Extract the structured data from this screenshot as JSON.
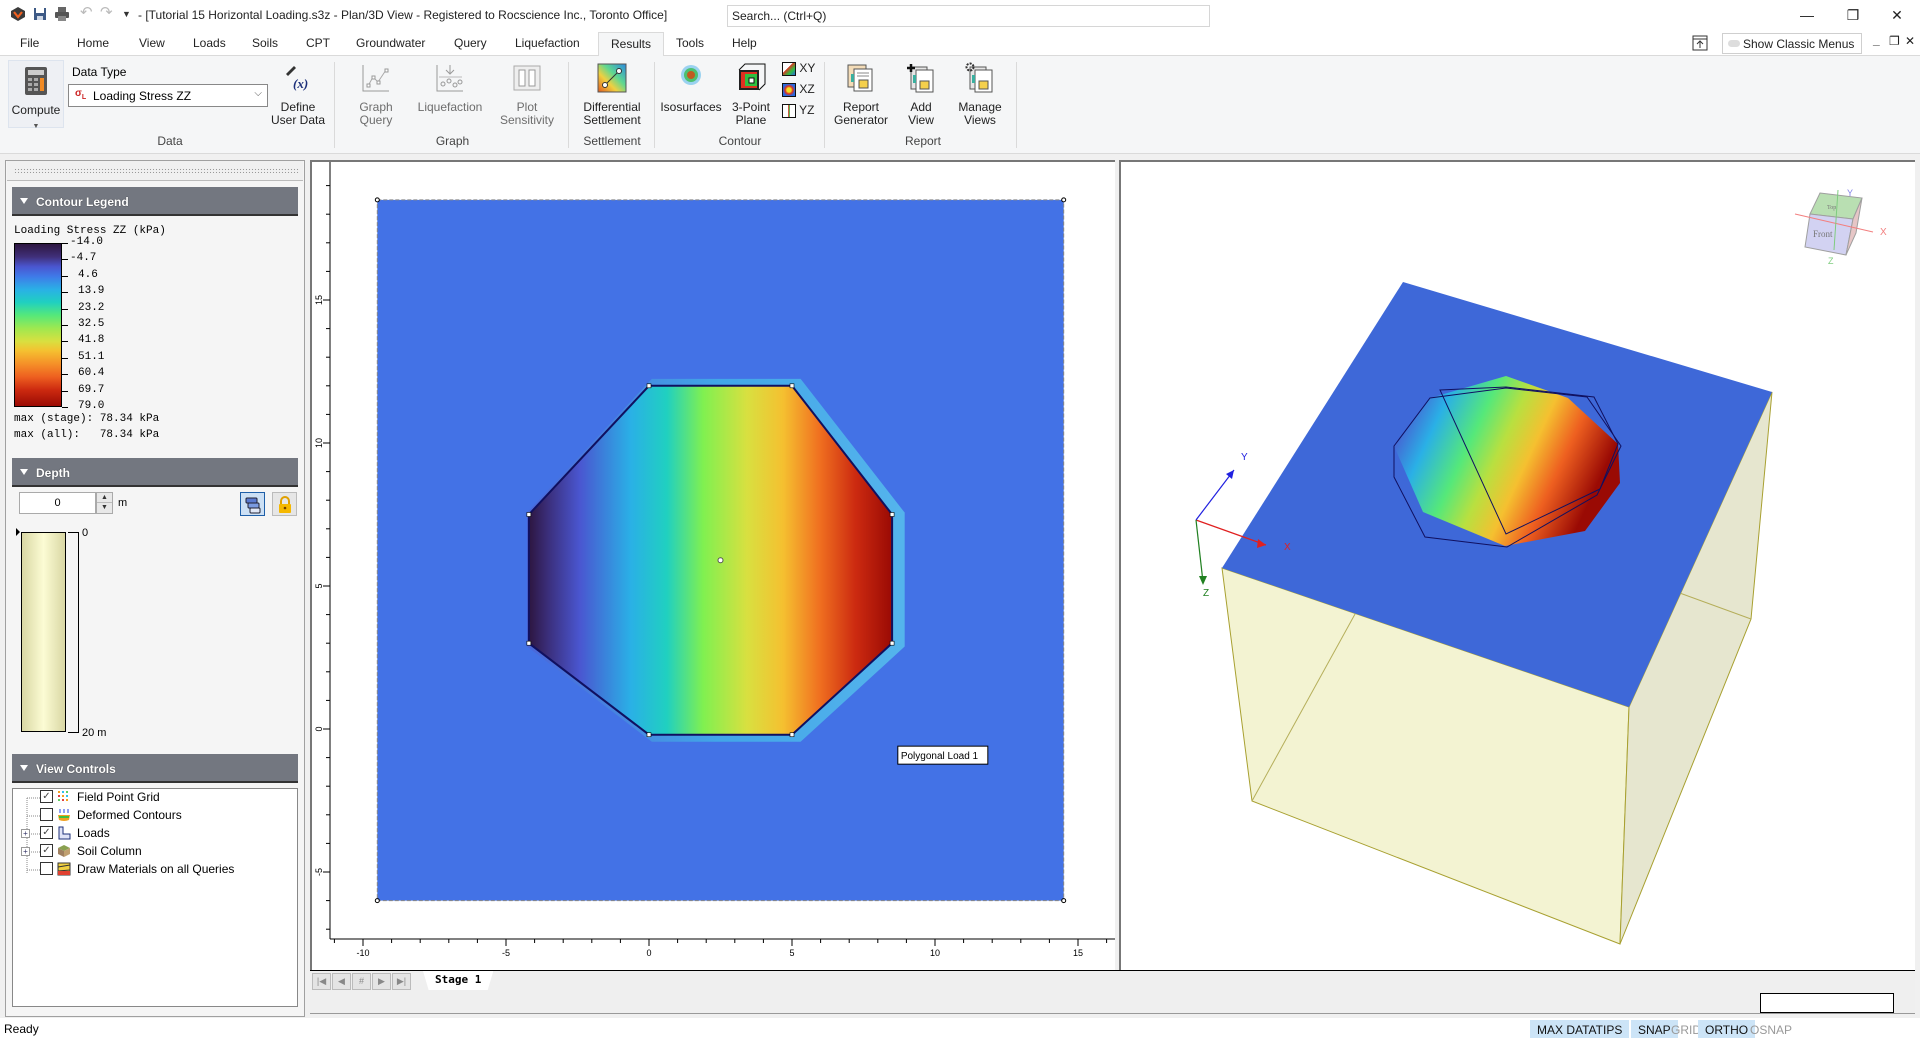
{
  "window": {
    "title": "- [Tutorial 15 Horizontal Loading.s3z - Plan/3D View - Registered to Rocscience Inc., Toronto Office]",
    "search_placeholder": "Search... (Ctrl+Q)",
    "minimize": "—",
    "maximize": "❐",
    "close": "✕",
    "quick_access": [
      "app-logo-icon",
      "save-icon",
      "print-icon",
      "undo-icon",
      "redo-icon",
      "customize-dropdown-icon"
    ]
  },
  "menu": {
    "tabs": [
      "File",
      "Home",
      "View",
      "Loads",
      "Soils",
      "CPT",
      "Groundwater",
      "Query",
      "Liquefaction",
      "Results",
      "Tools",
      "Help"
    ],
    "active_tab": "Results",
    "show_classic_menus": "Show Classic Menus",
    "doc_minimize": "_",
    "doc_restore": "❐",
    "doc_close": "✕"
  },
  "ribbon": {
    "groups": {
      "data": "Data",
      "graph": "Graph",
      "settlement": "Settlement",
      "contour": "Contour",
      "report": "Report"
    },
    "compute": "Compute",
    "data_type_label": "Data Type",
    "data_type_value": "Loading Stress ZZ",
    "define_user_data": [
      "Define",
      "User Data"
    ],
    "graph_query": [
      "Graph",
      "Query"
    ],
    "liquefaction": "Liquefaction",
    "plot_sensitivity": [
      "Plot",
      "Sensitivity"
    ],
    "differential_settlement": [
      "Differential",
      "Settlement"
    ],
    "isosurfaces": "Isosurfaces",
    "three_point_plane": [
      "3-Point",
      "Plane"
    ],
    "plane_xy": "XY",
    "plane_xz": "XZ",
    "plane_yz": "YZ",
    "report_generator": [
      "Report",
      "Generator"
    ],
    "add_view": [
      "Add",
      "View"
    ],
    "manage_views": [
      "Manage",
      "Views"
    ]
  },
  "left_panel": {
    "contour_legend": {
      "header": "Contour Legend",
      "title": "Loading Stress ZZ (kPa)",
      "values": [
        "-14.0",
        "-4.7",
        "4.6",
        "13.9",
        "23.2",
        "32.5",
        "41.8",
        "51.1",
        "60.4",
        "69.7",
        "79.0"
      ],
      "max_stage": "max (stage): 78.34 kPa",
      "max_all": "max (all):   78.34 kPa",
      "colors": [
        "#2d1640",
        "#4a56d0",
        "#3f7ae8",
        "#2ab0e6",
        "#20d0c0",
        "#55e87a",
        "#9ee850",
        "#d8e040",
        "#f5c030",
        "#ee6020",
        "#9a0a04"
      ]
    },
    "depth": {
      "header": "Depth",
      "value": "0",
      "unit": "m",
      "top_label": "0",
      "bottom_label": "20 m"
    },
    "view_controls": {
      "header": "View Controls",
      "items": [
        {
          "label": "Field Point Grid",
          "checked": true,
          "expandable": false,
          "icon": "field-point-grid-icon"
        },
        {
          "label": "Deformed Contours",
          "checked": false,
          "expandable": false,
          "icon": "deformed-contours-icon"
        },
        {
          "label": "Loads",
          "checked": true,
          "expandable": true,
          "icon": "loads-icon"
        },
        {
          "label": "Soil Column",
          "checked": true,
          "expandable": true,
          "icon": "soil-column-icon"
        },
        {
          "label": "Draw Materials on all Queries",
          "checked": false,
          "expandable": false,
          "icon": "draw-materials-icon"
        }
      ]
    }
  },
  "plan_view": {
    "x_ticks": [
      "-10",
      "-5",
      "0",
      "5",
      "10",
      "15"
    ],
    "y_ticks": [
      "15",
      "10",
      "5",
      "0",
      "-5"
    ],
    "load_label": "Polygonal Load 1",
    "load_polygon": [
      [
        -4.2,
        7.5
      ],
      [
        0,
        12
      ],
      [
        5,
        12
      ],
      [
        8.5,
        7.5
      ],
      [
        8.5,
        3
      ],
      [
        5,
        -0.2
      ],
      [
        0,
        -0.2
      ],
      [
        -4.2,
        3
      ]
    ],
    "grid_extent": {
      "x": [
        -9.5,
        14.5
      ],
      "y": [
        -6,
        18.5
      ]
    },
    "background_color": "#4372e6"
  },
  "view_3d": {
    "axis_labels": {
      "x": "X",
      "y": "Y",
      "z": "Z"
    },
    "view_cube": {
      "top": "Top",
      "front": "Front"
    }
  },
  "stage_tabs": {
    "nav": [
      "|◀",
      "◀",
      "#",
      "▶",
      "▶|"
    ],
    "tabs": [
      "Stage 1"
    ],
    "active": "Stage 1"
  },
  "status_bar": {
    "text": "Ready",
    "toggles": [
      {
        "label": "MAX DATATIPS",
        "on": true
      },
      {
        "label": "SNAP",
        "on": true
      },
      {
        "label": "GRID",
        "on": false
      },
      {
        "label": "ORTHO",
        "on": true
      },
      {
        "label": "OSNAP",
        "on": false
      }
    ]
  }
}
